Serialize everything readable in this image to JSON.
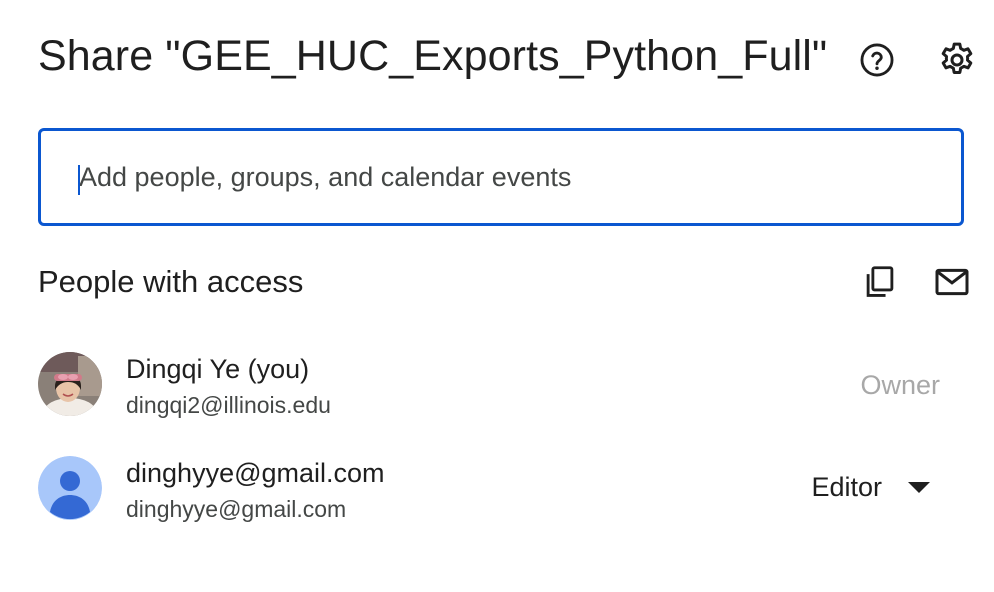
{
  "dialog": {
    "title": "Share \"GEE_HUC_Exports_Python_Full\"",
    "help_icon": "help-circle-icon",
    "settings_icon": "gear-icon"
  },
  "add_people": {
    "placeholder": "Add people, groups, and calendar events",
    "value": ""
  },
  "access": {
    "section_title": "People with access",
    "copy_icon": "copy-icon",
    "email_icon": "mail-icon",
    "people": [
      {
        "name": "Dingqi Ye (you)",
        "email": "dingqi2@illinois.edu",
        "role": "Owner",
        "avatar": "photo"
      },
      {
        "name": "dinghyye@gmail.com",
        "email": "dinghyye@gmail.com",
        "role": "Editor",
        "avatar": "default-person"
      }
    ]
  },
  "colors": {
    "accent": "#0b57d0",
    "text_primary": "#1f1f1f",
    "text_secondary": "#444746",
    "owner_role": "#a8a8a8",
    "default_avatar_bg": "#a8c7fa",
    "default_avatar_fg": "#3469d4"
  }
}
